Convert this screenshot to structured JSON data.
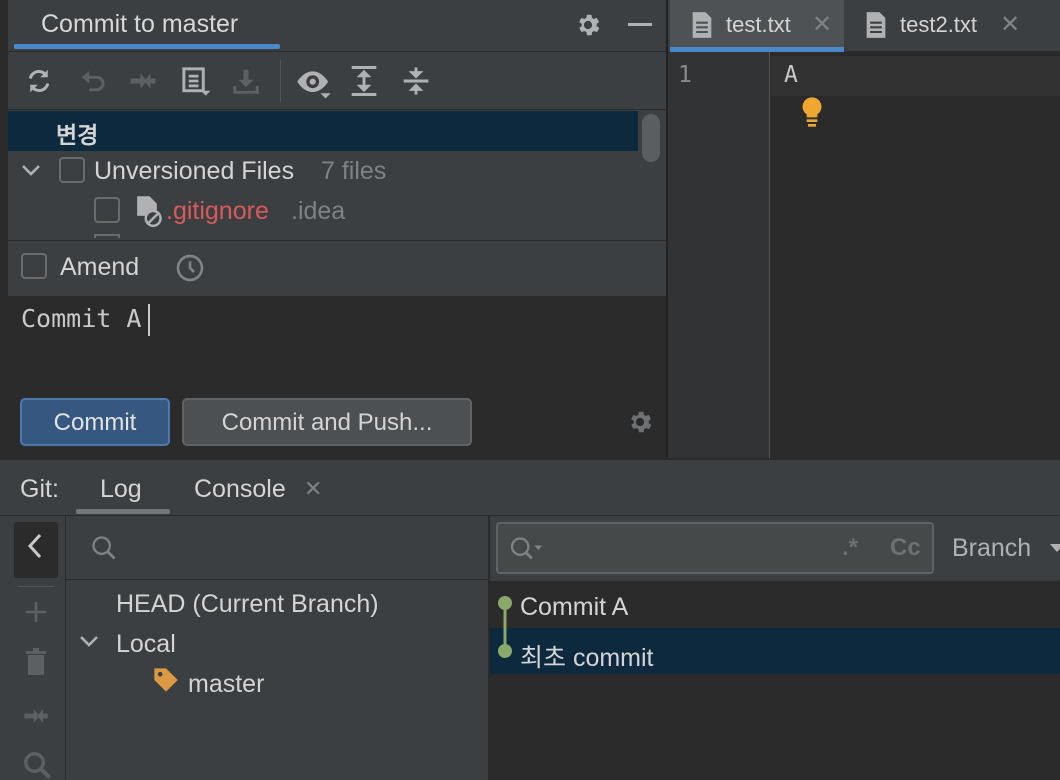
{
  "commit_panel": {
    "title": "Commit to master",
    "changes_header": "변경",
    "unversioned_label": "Unversioned Files",
    "unversioned_count": "7 files",
    "file_name": ".gitignore",
    "file_dir": ".idea",
    "amend_label": "Amend",
    "message": "Commit A",
    "commit_button": "Commit",
    "commit_push_button": "Commit and Push..."
  },
  "editor": {
    "tabs": [
      {
        "label": "test.txt",
        "active": true
      },
      {
        "label": "test2.txt",
        "active": false
      }
    ],
    "line_number": "1",
    "line_text": "A"
  },
  "git": {
    "label": "Git:",
    "tabs": [
      {
        "label": "Log",
        "active": true
      },
      {
        "label": "Console",
        "active": false
      }
    ],
    "branches": {
      "head": "HEAD (Current Branch)",
      "local": "Local",
      "master": "master"
    },
    "log_filter": {
      "regex": ".*",
      "case": "Cc",
      "branch": "Branch"
    },
    "commits": [
      {
        "message": "Commit A",
        "selected": false
      },
      {
        "message": "최초 commit",
        "selected": true
      }
    ]
  },
  "colors": {
    "background": "#2b2b2b",
    "panel": "#3c3f41",
    "selection": "#0d293e",
    "accent_blue": "#4a88c7",
    "unversioned_red": "#d95a5a",
    "graph_green": "#8aa86a",
    "bulb_yellow": "#f0a732",
    "tag_orange": "#d99a42"
  }
}
